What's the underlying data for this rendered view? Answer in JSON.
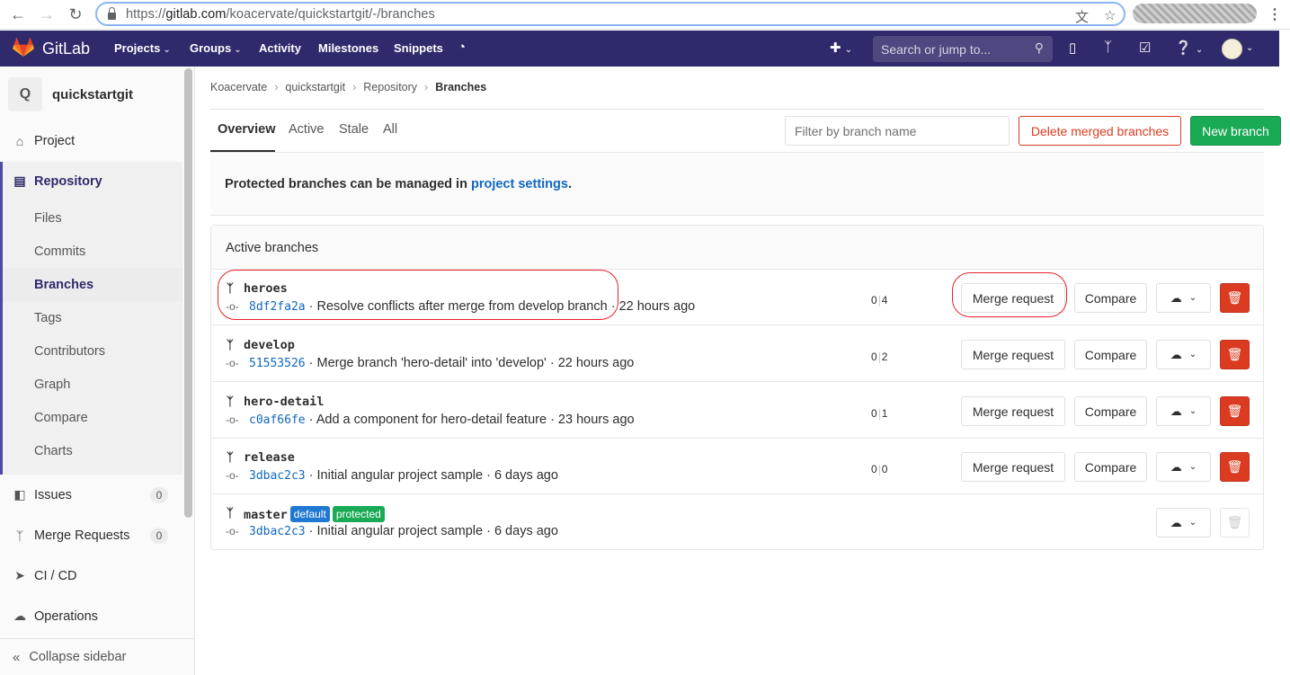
{
  "browser": {
    "url_prefix": "https://",
    "url_host": "gitlab.com",
    "url_path": "/koacervate/quickstartgit/-/branches"
  },
  "topnav": {
    "brand": "GitLab",
    "items": [
      "Projects",
      "Groups",
      "Activity",
      "Milestones",
      "Snippets"
    ],
    "search_placeholder": "Search or jump to..."
  },
  "sidebar": {
    "project_initial": "Q",
    "project_name": "quickstartgit",
    "project": "Project",
    "repository": "Repository",
    "repo_items": [
      "Files",
      "Commits",
      "Branches",
      "Tags",
      "Contributors",
      "Graph",
      "Compare",
      "Charts"
    ],
    "issues": "Issues",
    "issues_count": "0",
    "merge_requests": "Merge Requests",
    "mr_count": "0",
    "cicd": "CI / CD",
    "operations": "Operations",
    "collapse": "Collapse sidebar"
  },
  "breadcrumb": [
    "Koacervate",
    "quickstartgit",
    "Repository",
    "Branches"
  ],
  "tabs": [
    "Overview",
    "Active",
    "Stale",
    "All"
  ],
  "filter_placeholder": "Filter by branch name",
  "delete_merged_label": "Delete merged branches",
  "new_branch_label": "New branch",
  "info": {
    "text": "Protected branches can be managed in ",
    "link": "project settings",
    "end": "."
  },
  "panel_title": "Active branches",
  "buttons": {
    "merge_request": "Merge request",
    "compare": "Compare"
  },
  "branches": [
    {
      "name": "heroes",
      "sha": "8df2fa2a",
      "message": " · Resolve conflicts after merge from develop branch · 22 hours ago",
      "behind": "0",
      "ahead": "4"
    },
    {
      "name": "develop",
      "sha": "51553526",
      "message": " · Merge branch 'hero-detail' into 'develop' · 22 hours ago",
      "behind": "0",
      "ahead": "2"
    },
    {
      "name": "hero-detail",
      "sha": "c0af66fe",
      "message": " · Add a component for hero-detail feature · 23 hours ago",
      "behind": "0",
      "ahead": "1"
    },
    {
      "name": "release",
      "sha": "3dbac2c3",
      "message": " · Initial angular project sample · 6 days ago",
      "behind": "0",
      "ahead": "0"
    },
    {
      "name": "master",
      "sha": "3dbac2c3",
      "message": " · Initial angular project sample · 6 days ago",
      "badge_default": "default",
      "badge_protected": "protected"
    }
  ],
  "colors": {
    "nav": "#2f2a6b",
    "danger": "#db3b21",
    "success": "#1aaa55",
    "link": "#1068bf",
    "annotation": "#e8202a"
  }
}
